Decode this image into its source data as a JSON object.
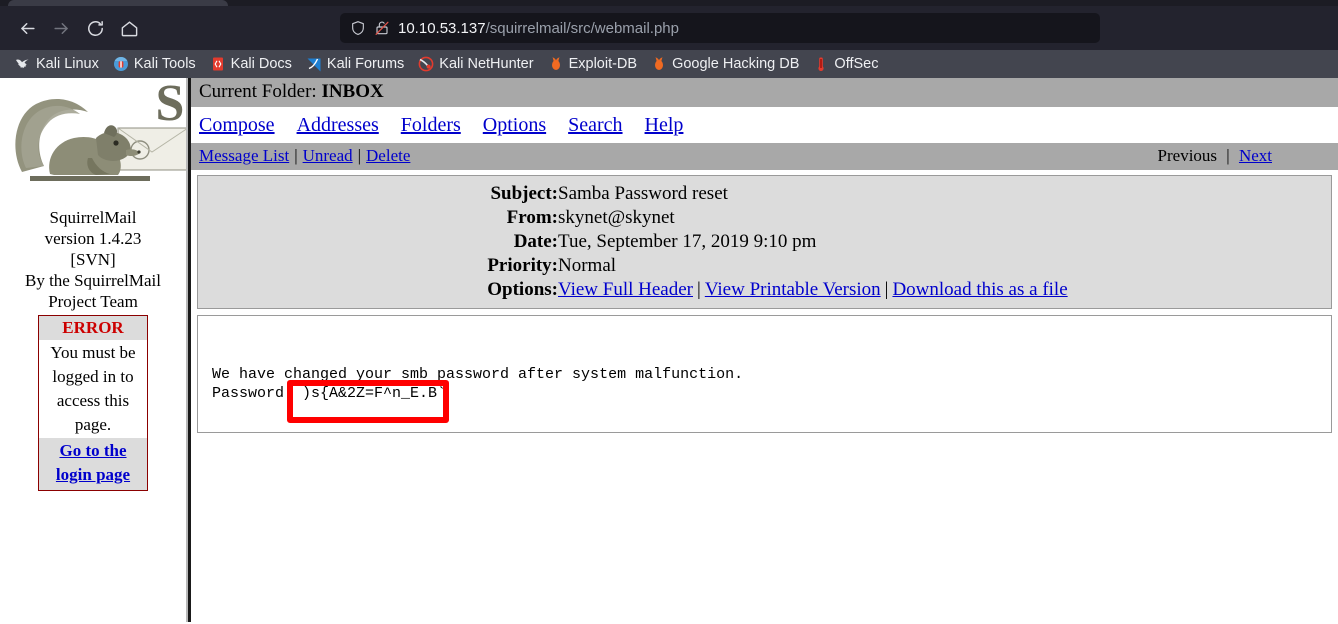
{
  "browser": {
    "nav": {
      "back": "back-arrow",
      "forward": "forward-arrow",
      "reload": "reload",
      "home": "home"
    },
    "urlbar": {
      "shield_icon": "shield-icon",
      "lock_icon": "lock-broken-icon",
      "host": "10.10.53.137",
      "path": "/squirrelmail/src/webmail.php",
      "full_url": "10.10.53.137/squirrelmail/src/webmail.php"
    },
    "bookmarks": [
      {
        "label": "Kali Linux",
        "icon": "kali-dragon-icon"
      },
      {
        "label": "Kali Tools",
        "icon": "kali-tools-icon"
      },
      {
        "label": "Kali Docs",
        "icon": "kali-docs-icon"
      },
      {
        "label": "Kali Forums",
        "icon": "kali-forums-icon"
      },
      {
        "label": "Kali NetHunter",
        "icon": "kali-nethunter-icon"
      },
      {
        "label": "Exploit-DB",
        "icon": "exploit-db-icon"
      },
      {
        "label": "Google Hacking DB",
        "icon": "google-hacking-db-icon"
      },
      {
        "label": "OffSec",
        "icon": "offsec-icon"
      }
    ]
  },
  "sidebar": {
    "logo_alt": "squirrelmail-logo",
    "version_line1": "SquirrelMail",
    "version_line2": "version 1.4.23",
    "version_line3": "[SVN]",
    "version_line4": "By the SquirrelMail",
    "version_line5": "Project Team",
    "error": {
      "title": "ERROR",
      "message": "You must be logged in to access this page.",
      "link_label": "Go to the login page"
    }
  },
  "webmail": {
    "folder_bar": {
      "prefix": "Current Folder:",
      "folder": "INBOX"
    },
    "main_menu": [
      "Compose",
      "Addresses",
      "Folders",
      "Options",
      "Search",
      "Help"
    ],
    "message_toolbar": {
      "message_list": "Message List",
      "unread": "Unread",
      "delete": "Delete",
      "separator": "|",
      "previous": "Previous",
      "next": "Next"
    },
    "message_headers": [
      {
        "label": "Subject:",
        "value": "Samba Password reset",
        "type": "text"
      },
      {
        "label": "From:",
        "value": "skynet@skynet",
        "type": "text"
      },
      {
        "label": "Date:",
        "value": "Tue, September 17, 2019 9:10 pm",
        "type": "text"
      },
      {
        "label": "Priority:",
        "value": "Normal",
        "type": "text"
      }
    ],
    "options_row": {
      "label": "Options:",
      "links": [
        "View Full Header",
        "View Printable Version",
        "Download this as a file"
      ],
      "separator": "|"
    },
    "message_body": {
      "line1": "We have changed your smb password after system malfunction.",
      "line2_label": "Password",
      "line2_value": ")s{A&2Z=F^n_E.B`",
      "full": "We have changed your smb password after system malfunction.\nPassword  )s{A&2Z=F^n_E.B`"
    },
    "annotation": {
      "name": "red-highlight-box",
      "color": "#ff0000"
    }
  },
  "colors": {
    "chrome_toolbar": "#23232e",
    "bookmarks_bar": "#43454f",
    "urlbar_bg": "#15151c",
    "sm_header_gray": "#a8a8a8",
    "sm_panel_gray": "#dcdcdc",
    "link_blue": "#0000cc",
    "error_red": "#cc0000",
    "annotation_red": "#ff0000"
  }
}
